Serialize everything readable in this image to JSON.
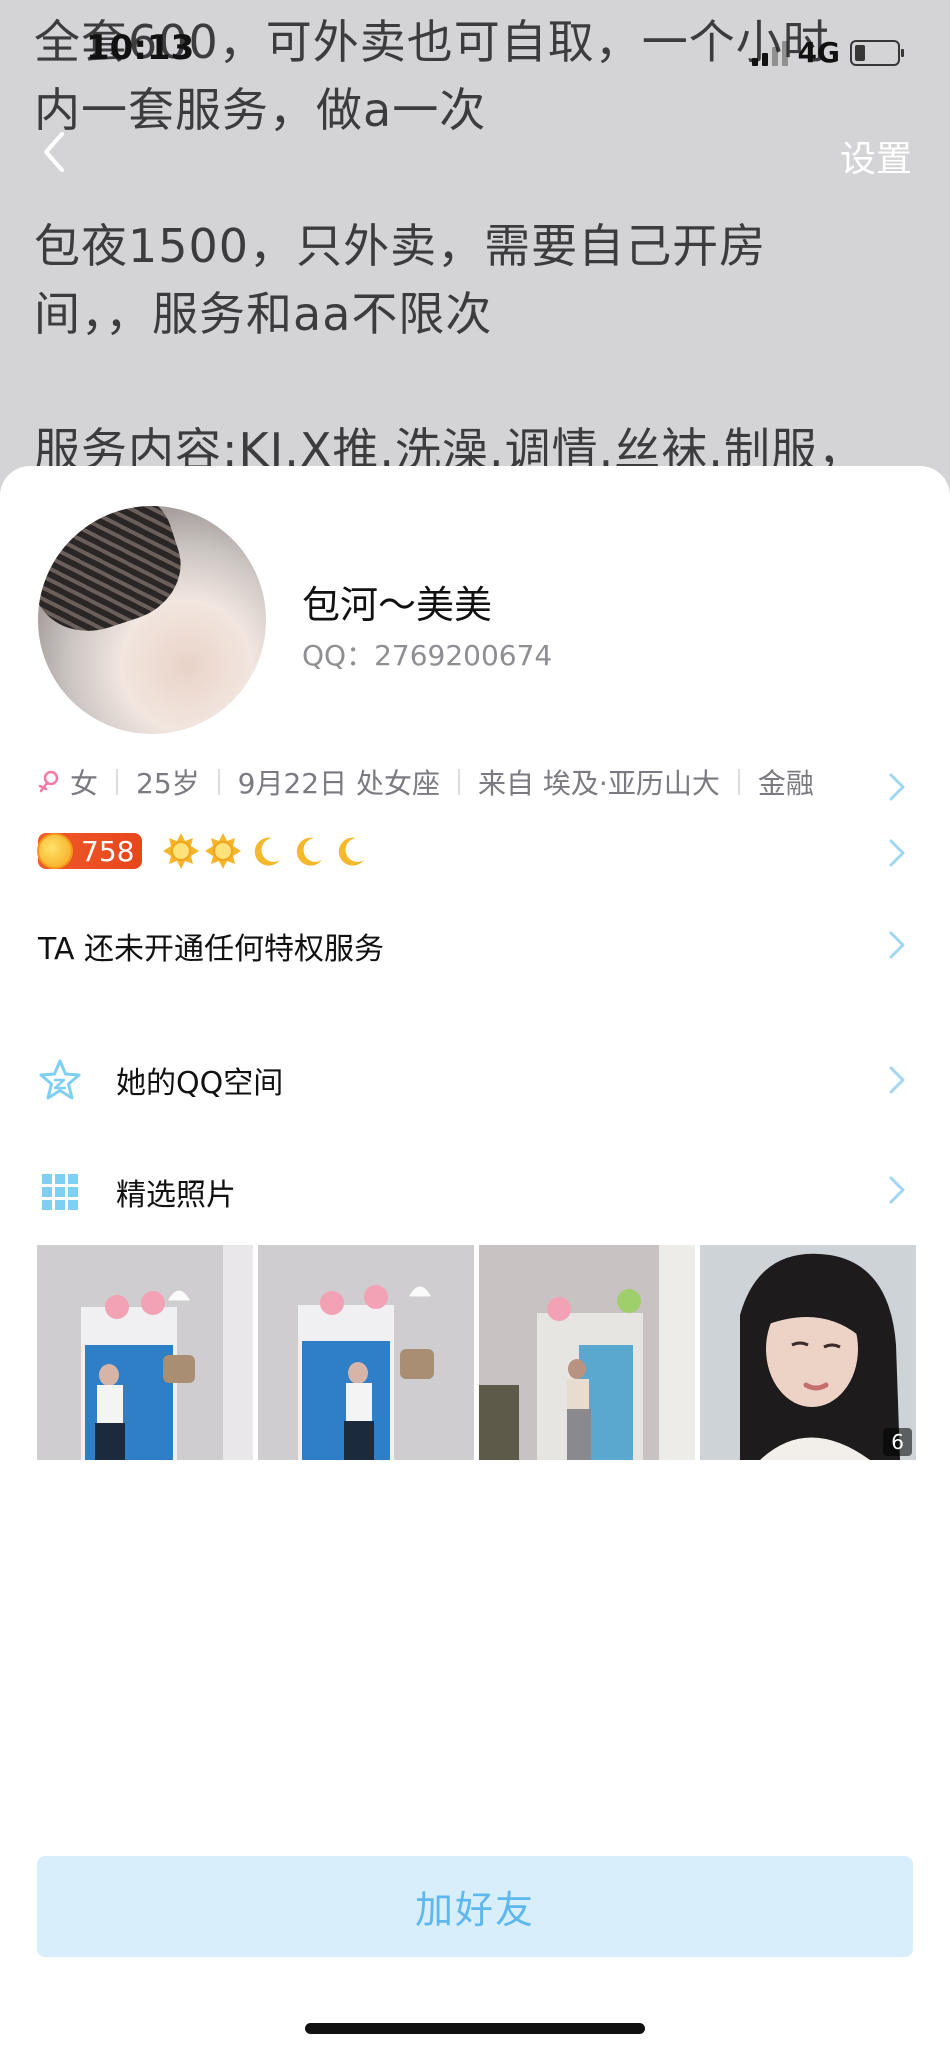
{
  "status_bar": {
    "time": "10:13",
    "network": "4G"
  },
  "background_note": {
    "lines": [
      "   全套600，可外卖也可自取，一个小时",
      "内一套服务，做a一次",
      "   包夜1500，只外卖，需要自己开房",
      "间，，服务和aa不限次",
      "  服务内容:KJ.X推.洗澡.调情.丝袜.制服，"
    ]
  },
  "nav": {
    "back_icon": "chevron-left-icon",
    "settings_label": "设置"
  },
  "profile": {
    "nickname": "包河～美美",
    "qq_label": "QQ：2769200674",
    "info": {
      "gender": "女",
      "age": "25岁",
      "birthday": "9月22日 处女座",
      "hometown": "来自 埃及·亚历山大",
      "industry": "金融"
    },
    "level": {
      "number": "758",
      "icons": [
        "sun-icon",
        "sun-icon",
        "moon-icon",
        "moon-icon",
        "moon-icon"
      ]
    },
    "privilege_text": "TA 还未开通任何特权服务"
  },
  "menu": {
    "qzone_label": "她的QQ空间",
    "photos_label": "精选照片"
  },
  "photos": {
    "count": "6"
  },
  "actions": {
    "add_friend_label": "加好友"
  },
  "colors": {
    "accent": "#5db8ee",
    "button_bg": "#d9eefb",
    "icon_blue": "#7ecff3"
  }
}
